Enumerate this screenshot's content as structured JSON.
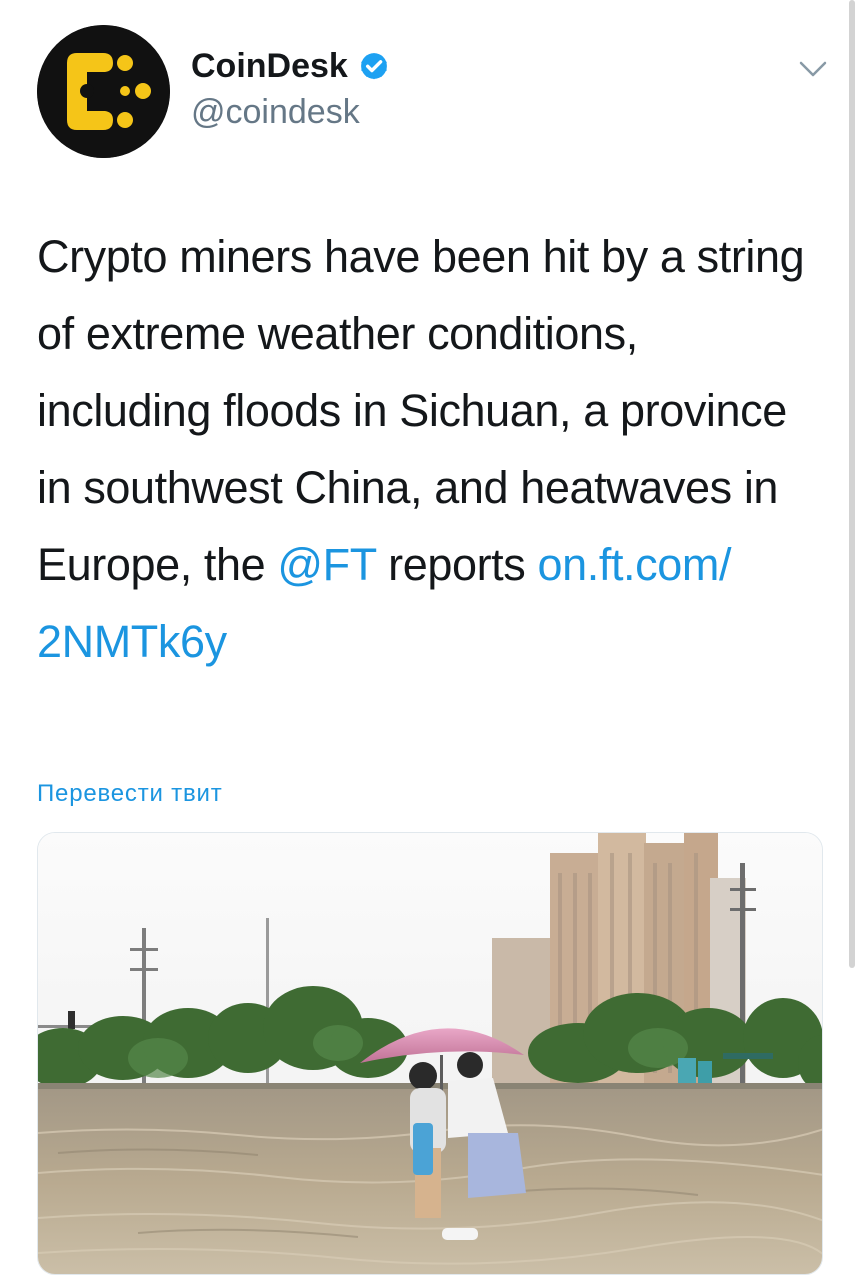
{
  "tweet": {
    "author": {
      "display_name": "CoinDesk",
      "handle": "@coindesk",
      "verified": true,
      "avatar_icon": "coindesk-logo",
      "avatar_colors": {
        "background": "#111111",
        "mark": "#f5c518"
      }
    },
    "text_parts": {
      "t1": "Crypto miners have been hit by a string of extreme weather conditions, including floods in Sichuan, a province in southwest China, and heatwaves in Europe, the ",
      "mention": "@FT",
      "t2": " reports ",
      "link": "on.ft.com/ 2NMTk6y"
    },
    "translate_label": "Перевести твит",
    "menu_icon": "chevron-down-icon",
    "media": {
      "type": "photo",
      "subject": "flooded street with two people under a pink umbrella"
    }
  },
  "colors": {
    "link": "#1b95e0",
    "text": "#14171a",
    "secondary": "#657786",
    "verified_badge": "#1da1f2"
  }
}
